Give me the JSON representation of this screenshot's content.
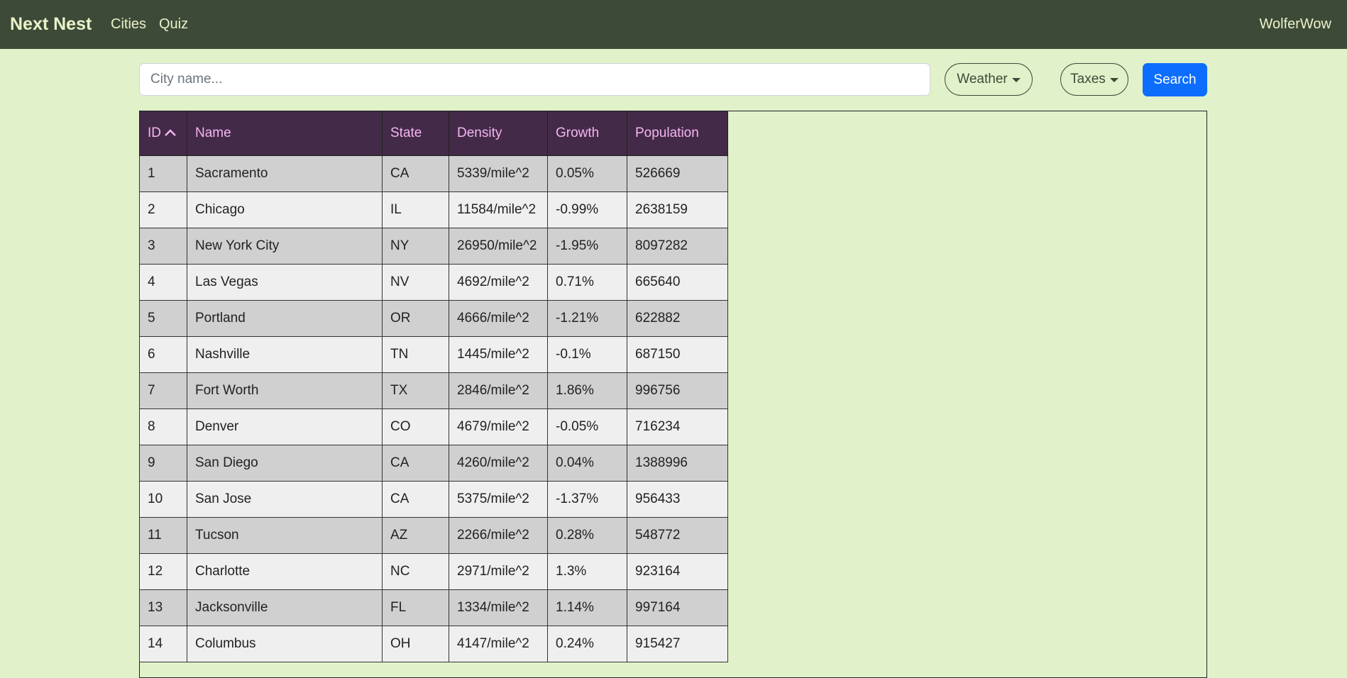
{
  "nav": {
    "brand": "Next Nest",
    "links": [
      "Cities",
      "Quiz"
    ],
    "user": "WolferWow"
  },
  "search": {
    "placeholder": "City name...",
    "value": "",
    "weather_label": "Weather",
    "taxes_label": "Taxes",
    "search_label": "Search"
  },
  "table": {
    "columns": [
      "ID",
      "Name",
      "State",
      "Density",
      "Growth",
      "Population"
    ],
    "sort_column": "ID",
    "sort_direction": "ascending",
    "sort_icon": "chevron-up-icon",
    "rows": [
      [
        "1",
        "Sacramento",
        "CA",
        "5339/mile^2",
        "0.05%",
        "526669"
      ],
      [
        "2",
        "Chicago",
        "IL",
        "11584/mile^2",
        "-0.99%",
        "2638159"
      ],
      [
        "3",
        "New York City",
        "NY",
        "26950/mile^2",
        "-1.95%",
        "8097282"
      ],
      [
        "4",
        "Las Vegas",
        "NV",
        "4692/mile^2",
        "0.71%",
        "665640"
      ],
      [
        "5",
        "Portland",
        "OR",
        "4666/mile^2",
        "-1.21%",
        "622882"
      ],
      [
        "6",
        "Nashville",
        "TN",
        "1445/mile^2",
        "-0.1%",
        "687150"
      ],
      [
        "7",
        "Fort Worth",
        "TX",
        "2846/mile^2",
        "1.86%",
        "996756"
      ],
      [
        "8",
        "Denver",
        "CO",
        "4679/mile^2",
        "-0.05%",
        "716234"
      ],
      [
        "9",
        "San Diego",
        "CA",
        "4260/mile^2",
        "0.04%",
        "1388996"
      ],
      [
        "10",
        "San Jose",
        "CA",
        "5375/mile^2",
        "-1.37%",
        "956433"
      ],
      [
        "11",
        "Tucson",
        "AZ",
        "2266/mile^2",
        "0.28%",
        "548772"
      ],
      [
        "12",
        "Charlotte",
        "NC",
        "2971/mile^2",
        "1.3%",
        "923164"
      ],
      [
        "13",
        "Jacksonville",
        "FL",
        "1334/mile^2",
        "1.14%",
        "997164"
      ],
      [
        "14",
        "Columbus",
        "OH",
        "4147/mile^2",
        "0.24%",
        "915427"
      ]
    ]
  },
  "colors": {
    "navbar": "#3e4a38",
    "page_background": "#e1f2cb",
    "table_header": "#432a48",
    "table_header_text": "#f4b6f0",
    "row_odd": "#d0d0d0",
    "row_even": "#efefef",
    "primary_button": "#0d6efd"
  }
}
